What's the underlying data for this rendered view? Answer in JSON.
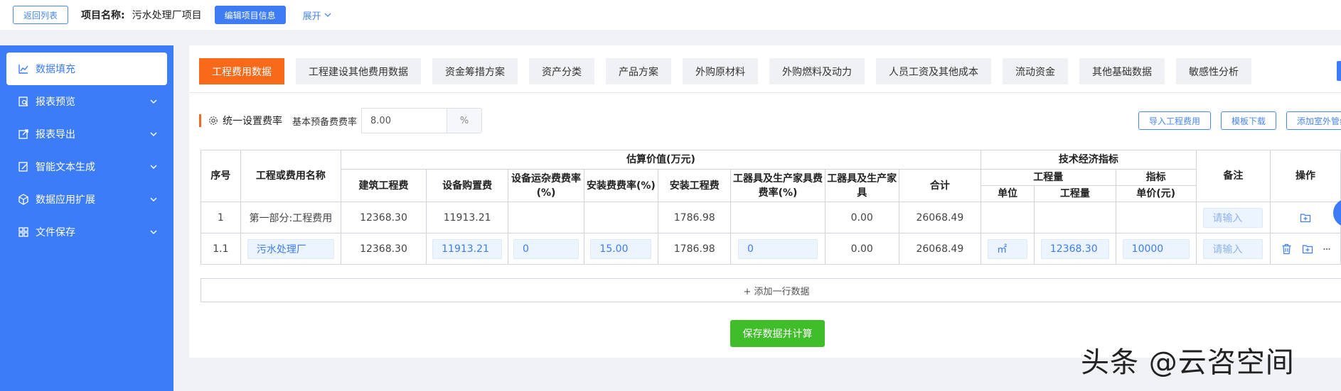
{
  "topbar": {
    "back_label": "返回列表",
    "project_label": "项目名称:",
    "project_name": "污水处理厂项目",
    "edit_label": "编辑项目信息",
    "expand_label": "展开"
  },
  "sidebar": {
    "items": [
      {
        "label": "数据填充",
        "icon": "line-chart-icon",
        "active": true
      },
      {
        "label": "报表预览",
        "icon": "search-doc-icon"
      },
      {
        "label": "报表导出",
        "icon": "export-icon"
      },
      {
        "label": "智能文本生成",
        "icon": "edit-doc-icon"
      },
      {
        "label": "数据应用扩展",
        "icon": "cube-icon"
      },
      {
        "label": "文件保存",
        "icon": "grid-icon"
      }
    ]
  },
  "tabs": [
    {
      "label": "工程费用数据",
      "active": true
    },
    {
      "label": "工程建设其他费用数据"
    },
    {
      "label": "资金筹措方案"
    },
    {
      "label": "资产分类"
    },
    {
      "label": "产品方案"
    },
    {
      "label": "外购原材料"
    },
    {
      "label": "外购燃料及动力"
    },
    {
      "label": "人员工资及其他成本"
    },
    {
      "label": "流动资金"
    },
    {
      "label": "其他基础数据"
    },
    {
      "label": "敏感性分析"
    }
  ],
  "rate": {
    "title": "统一设置费率",
    "label": "基本预备费费率",
    "value": "8.00",
    "unit": "%"
  },
  "right_buttons": {
    "import": "导入工程费用",
    "template": "模板下载",
    "add_outdoor": "添加室外管线"
  },
  "table": {
    "headers": {
      "index": "序号",
      "name": "工程或费用名称",
      "estimate_group": "估算价值(万元)",
      "tech_group": "技术经济指标",
      "remark": "备注",
      "ops": "操作",
      "build": "建筑工程费",
      "equip": "设备购置费",
      "transport": "设备运杂费费率(%)",
      "install_rate": "安装费费率(%)",
      "install": "安装工程费",
      "tools_rate": "工器具及生产家具费费率(%)",
      "tools": "工器具及生产家具",
      "total": "合计",
      "qty_group": "工程量",
      "index_group": "指标",
      "unit": "单位",
      "qty": "工程量",
      "unit_price": "单价(元)"
    },
    "rows": [
      {
        "index": "1",
        "name": "第一部分:工程费用",
        "build": "12368.30",
        "equip": "11913.21",
        "transport": "",
        "install_rate": "",
        "install": "1786.98",
        "tools_rate": "",
        "tools": "0.00",
        "total": "26068.49",
        "unit": "",
        "qty": "",
        "unit_price": "",
        "remark_placeholder": "请输入"
      },
      {
        "index": "1.1",
        "name": "污水处理厂",
        "build": "12368.30",
        "equip": "11913.21",
        "transport": "0",
        "install_rate": "15.00",
        "install": "1786.98",
        "tools_rate": "0",
        "tools": "0.00",
        "total": "26068.49",
        "unit": "㎡",
        "qty": "12368.30",
        "unit_price": "10000",
        "remark_placeholder": "请输入"
      }
    ],
    "add_row_label": "+ 添加一行数据"
  },
  "save_label": "保存数据并计算",
  "watermark": "头条 @云咨空间",
  "colors": {
    "sidebar": "#3c7cf6",
    "active_tab": "#f86a1a",
    "save": "#3fbe2a"
  }
}
